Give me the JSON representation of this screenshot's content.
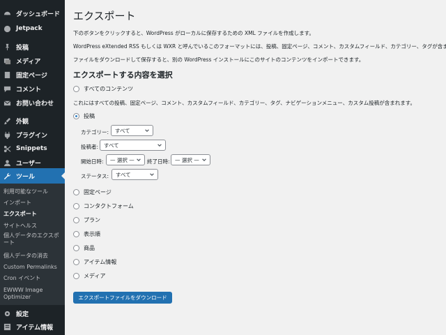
{
  "sidebar": {
    "top_items": [
      {
        "label": "ダッシュボード",
        "icon": "dashboard-icon"
      },
      {
        "label": "Jetpack",
        "icon": "jetpack-icon"
      },
      {
        "label": "投稿",
        "icon": "pin-icon"
      },
      {
        "label": "メディア",
        "icon": "media-icon"
      },
      {
        "label": "固定ページ",
        "icon": "page-icon"
      },
      {
        "label": "コメント",
        "icon": "comment-icon"
      },
      {
        "label": "お問い合わせ",
        "icon": "mail-icon"
      },
      {
        "label": "外観",
        "icon": "brush-icon"
      },
      {
        "label": "プラグイン",
        "icon": "plugin-icon"
      },
      {
        "label": "Snippets",
        "icon": "snippets-icon"
      },
      {
        "label": "ユーザー",
        "icon": "user-icon"
      },
      {
        "label": "ツール",
        "icon": "wrench-icon"
      }
    ],
    "sub_items": [
      {
        "label": "利用可能なツール"
      },
      {
        "label": "インポート"
      },
      {
        "label": "エクスポート"
      },
      {
        "label": "サイトヘルス"
      },
      {
        "label": "個人データのエクスポート"
      },
      {
        "label": "個人データの消去"
      },
      {
        "label": "Custom Permalinks"
      },
      {
        "label": "Cron イベント"
      },
      {
        "label": "EWWW Image Optimizer"
      }
    ],
    "bottom_items": [
      {
        "label": "設定",
        "icon": "settings-icon"
      },
      {
        "label": "アイテム情報",
        "icon": "item-icon"
      }
    ]
  },
  "page": {
    "title": "エクスポート",
    "desc1": "下のボタンをクリックすると、WordPress がローカルに保存するための XML ファイルを作成します。",
    "desc2": "WordPress eXtended RSS もしくは WXR と呼んでいるこのフォーマットには、投稿、固定ページ、コメント、カスタムフィールド、カテゴリー、タグが含まれます。",
    "desc3": "ファイルをダウンロードして保存すると、別の WordPress インストールにこのサイトのコンテンツをインポートできます。",
    "section_title": "エクスポートする内容を選択",
    "all_content_label": "すべてのコンテンツ",
    "all_content_note": "これにはすべての投稿、固定ページ、コメント、カスタムフィールド、カテゴリー、タグ、ナビゲーションメニュー、カスタム投稿が含まれます。",
    "posts_label": "投稿",
    "filters": {
      "category_label": "カテゴリー:",
      "category_value": "すべて",
      "author_label": "投稿者:",
      "author_value": "すべて",
      "start_label": "開始日時:",
      "start_value": "— 選択 —",
      "end_label": "終了日時:",
      "end_value": "— 選択 —",
      "status_label": "ステータス:",
      "status_value": "すべて"
    },
    "other_options": [
      "固定ページ",
      "コンタクトフォーム",
      "プラン",
      "表示順",
      "商品",
      "アイテム情報",
      "メディア"
    ],
    "download_button": "エクスポートファイルをダウンロード"
  }
}
